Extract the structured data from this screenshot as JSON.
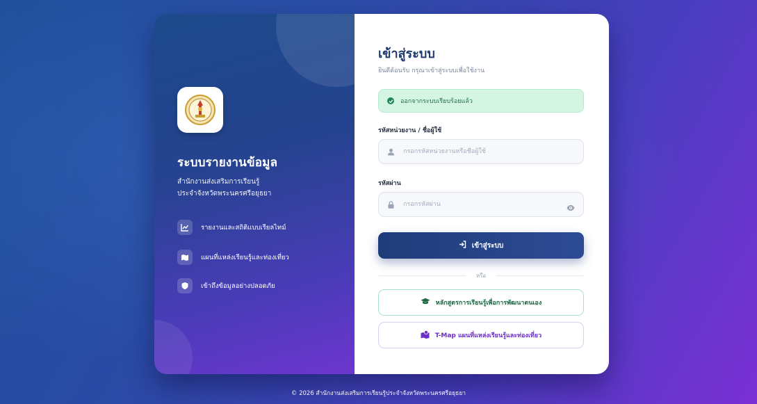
{
  "brand": {
    "title": "ระบบรายงานข้อมูล",
    "subtitle_line1": "สำนักงานส่งเสริมการเรียนรู้",
    "subtitle_line2": "ประจำจังหวัดพระนครศรีอยุธยา"
  },
  "features": [
    {
      "label": "รายงานและสถิติแบบเรียลไทม์",
      "icon": "chart-line-icon"
    },
    {
      "label": "แผนที่แหล่งเรียนรู้และท่องเที่ยว",
      "icon": "map-icon"
    },
    {
      "label": "เข้าถึงข้อมูลอย่างปลอดภัย",
      "icon": "shield-icon"
    }
  ],
  "login": {
    "title": "เข้าสู่ระบบ",
    "subtitle": "ยินดีต้อนรับ กรุณาเข้าสู่ระบบเพื่อใช้งาน",
    "alert": "ออกจากระบบเรียบร้อยแล้ว",
    "username_label": "รหัสหน่วยงาน / ชื่อผู้ใช้",
    "username_placeholder": "กรอกรหัสหน่วยงานหรือชื่อผู้ใช้",
    "username_value": "",
    "password_label": "รหัสผ่าน",
    "password_placeholder": "กรอกรหัสผ่าน",
    "password_value": "",
    "submit_label": "เข้าสู่ระบบ",
    "or_label": "หรือ",
    "course_button": "หลักสูตรการเรียนรู้เพื่อการพัฒนาตนเอง",
    "tmap_button": "T-Map แผนที่แหล่งเรียนรู้และท่องเที่ยว"
  },
  "footer": "© 2026 สำนักงานส่งเสริมการเรียนรู้ประจำจังหวัดพระนครศรีอยุธยา",
  "colors": {
    "primary": "#1f3c7a",
    "success_bg": "#d4f5e3",
    "success_text": "#1f6e46",
    "tmap_accent": "#6b2fc7"
  }
}
